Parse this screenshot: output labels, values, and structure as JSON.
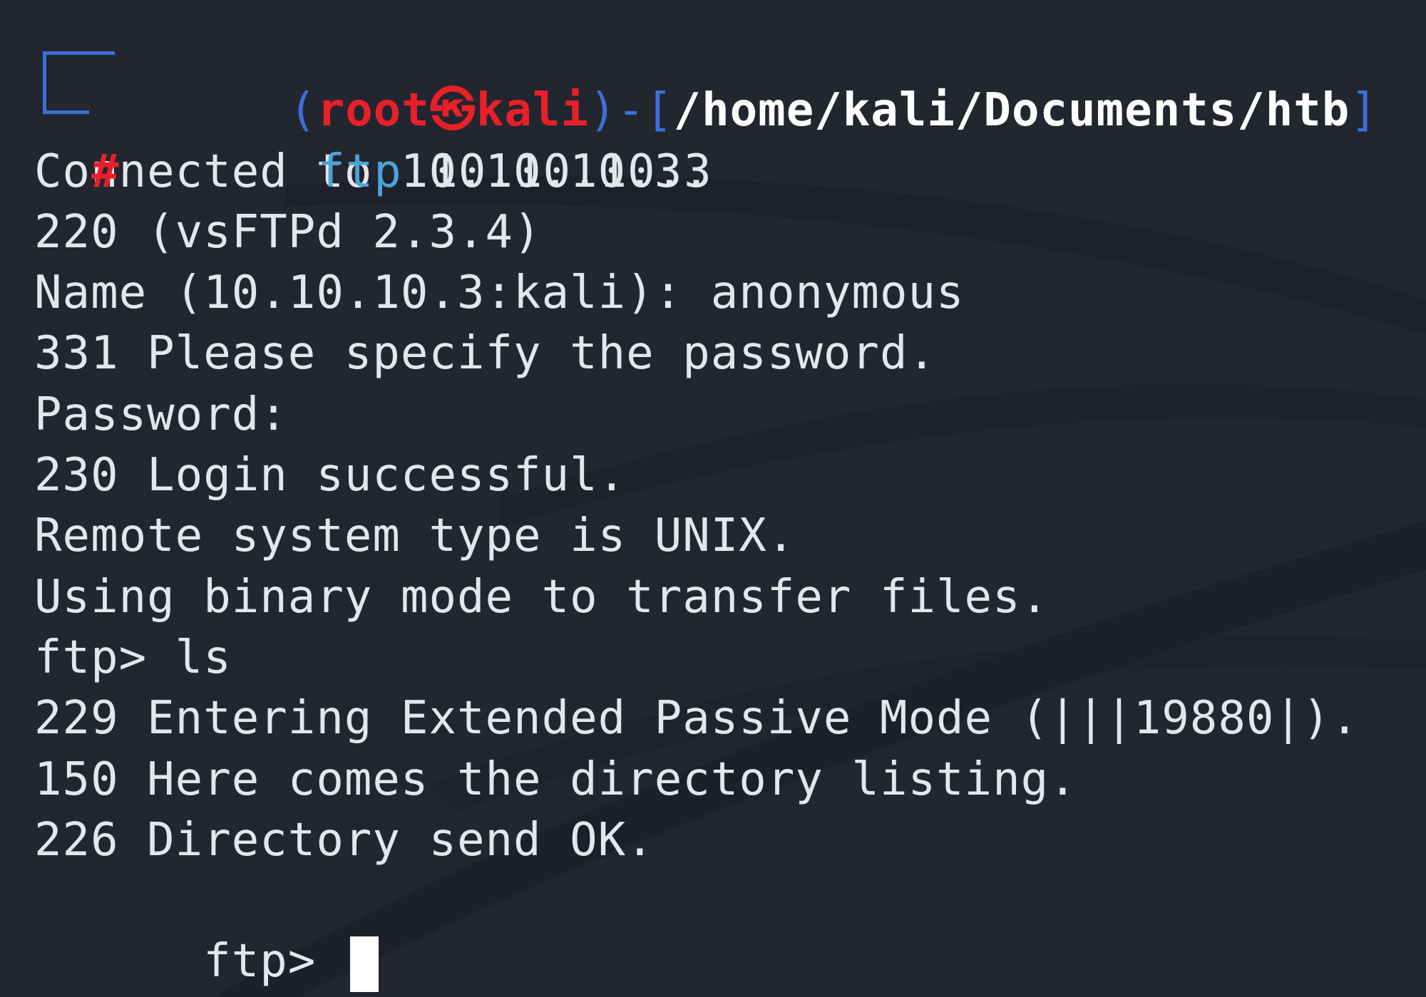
{
  "prompt": {
    "open_paren": "(",
    "user": "root",
    "at_symbol": "㉿",
    "host": "kali",
    "close_paren": ")",
    "dash_bracket": "-[",
    "path": "/home/kali/Documents/htb",
    "close_bracket": "]",
    "hash": "#",
    "command": "ftp",
    "argument": "10.10.10.3"
  },
  "output_lines": [
    "Connected to 10.10.10.3.",
    "220 (vsFTPd 2.3.4)",
    "Name (10.10.10.3:kali): anonymous",
    "331 Please specify the password.",
    "Password:",
    "230 Login successful.",
    "Remote system type is UNIX.",
    "Using binary mode to transfer files.",
    "ftp> ls",
    "229 Entering Extended Passive Mode (|||19880|).",
    "150 Here comes the directory listing.",
    "226 Directory send OK."
  ],
  "active_prompt": "ftp>",
  "colors": {
    "background": "#22262f",
    "accent_blue": "#3d6fd6",
    "prompt_red": "#e8202a",
    "command_cyan": "#4ba3d8",
    "text": "#e4e6ea"
  }
}
